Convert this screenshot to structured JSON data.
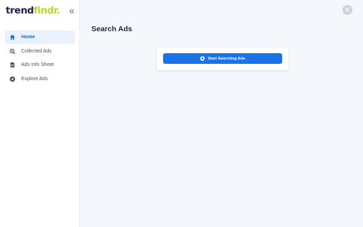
{
  "brand": {
    "name_part1": "trend",
    "name_part2": "findr."
  },
  "sidebar": {
    "collapse_icon": "double-chevron-left-icon",
    "items": [
      {
        "label": "Home",
        "icon": "home-icon",
        "active": true
      },
      {
        "label": "Collected Ads",
        "icon": "search-collection-icon",
        "active": false
      },
      {
        "label": "Ads Info Sheet",
        "icon": "document-icon",
        "active": false
      },
      {
        "label": "Explore Ads",
        "icon": "compass-icon",
        "active": false
      }
    ]
  },
  "header": {
    "avatar_initial": "D"
  },
  "main": {
    "title": "Search Ads",
    "start_button": {
      "label": "Start Searching Ads",
      "icon": "plus-circle-icon"
    }
  },
  "colors": {
    "accent": "#1b73e8",
    "brand_dark": "#1c1f4a",
    "brand_lime": "#b6d62b",
    "active_bg": "#eaf2fe"
  }
}
